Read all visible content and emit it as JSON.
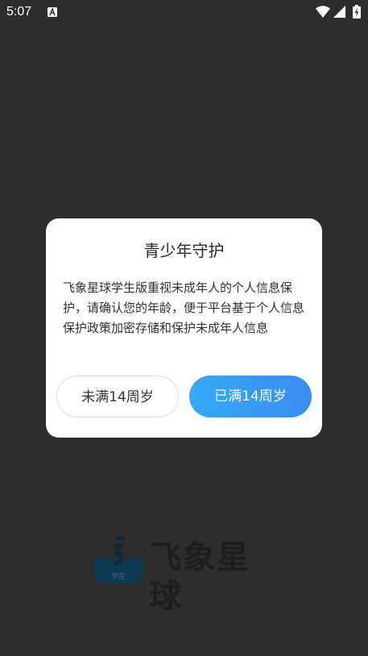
{
  "status_bar": {
    "time": "5:07",
    "icons": [
      "app-notification-icon",
      "wifi-icon",
      "signal-icon",
      "battery-charging-icon"
    ]
  },
  "dialog": {
    "title": "青少年守护",
    "message": "飞象星球学生版重视未成年人的个人信息保护，请确认您的年龄，便于平台基于个人信息保护政策加密存储和保护未成年人信息",
    "under_14_label": "未满14周岁",
    "over_14_label": "已满14周岁"
  },
  "brand": {
    "name": "飞象星球",
    "badge": "学生"
  },
  "colors": {
    "background": "#2d2d2d",
    "dialog": "#ffffff",
    "primary_gradient_start": "#33aaf7",
    "primary_gradient_end": "#3d8cf5"
  }
}
